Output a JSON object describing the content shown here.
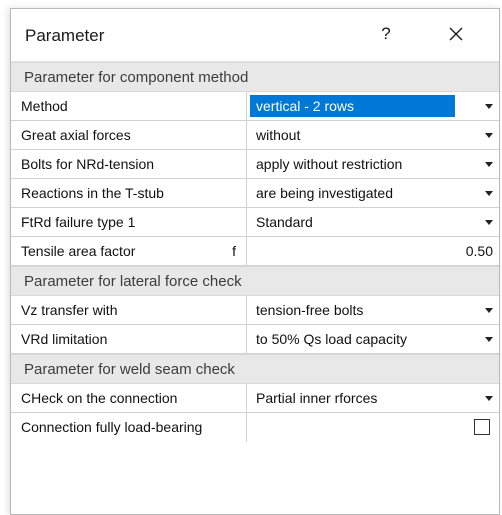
{
  "dialog": {
    "title": "Parameter",
    "help_label": "?",
    "close_icon": "close-icon"
  },
  "sections": {
    "component": "Parameter for component method",
    "lateral": "Parameter for lateral force check",
    "weld": "Parameter for weld seam check"
  },
  "rows": {
    "method": {
      "label": "Method",
      "value": "vertical - 2 rows"
    },
    "axial": {
      "label": "Great axial forces",
      "value": "without"
    },
    "bolts": {
      "label": "Bolts for NRd-tension",
      "value": "apply without restriction"
    },
    "reactions": {
      "label": "Reactions in the T-stub",
      "value": "are being investigated"
    },
    "ftrd": {
      "label": "FtRd failure type 1",
      "value": "Standard"
    },
    "tensile": {
      "label": "Tensile area factor",
      "symbol": "f",
      "value": "0.50"
    },
    "vz": {
      "label": "Vz transfer with",
      "value": "tension-free bolts"
    },
    "vrd": {
      "label": "VRd limitation",
      "value": "to 50% Qs load capacity"
    },
    "check": {
      "label": "CHeck on the connection",
      "value": "Partial inner rforces"
    },
    "fully": {
      "label": "Connection fully load-bearing",
      "checked": false
    }
  },
  "colors": {
    "selection": "#0078d7",
    "section_bg": "#e8e8e8",
    "grid": "#d2d2d2"
  }
}
